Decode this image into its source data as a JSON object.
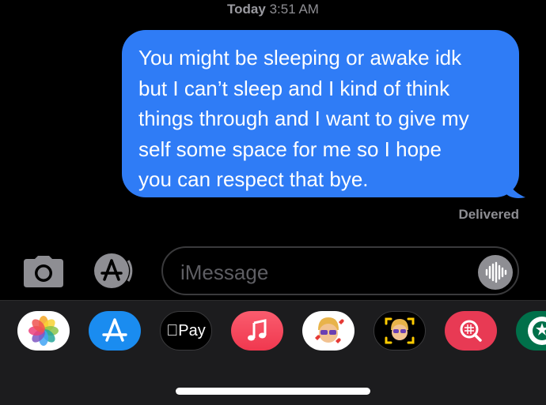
{
  "header": {
    "day": "Today",
    "time": "3:51 AM"
  },
  "message": {
    "text": "You might be sleeping or awake idk\nbut I can’t sleep and I kind of think\nthings through and I want to give my\nself some space for me  so I hope\nyou can respect that bye.",
    "status": "Delivered",
    "bubble_color": "#2f7cf6"
  },
  "composer": {
    "placeholder": "iMessage",
    "camera_icon": "camera-icon",
    "apps_icon": "app-store-icon",
    "audio_icon": "waveform-icon"
  },
  "app_tray": {
    "background": "#1c1c1e",
    "apps": [
      {
        "name": "Photos",
        "icon": "photos-icon"
      },
      {
        "name": "App Store",
        "icon": "app-store-icon"
      },
      {
        "name": "Apple Pay",
        "icon": "apple-pay-icon",
        "label": "Pay"
      },
      {
        "name": "Music",
        "icon": "music-icon"
      },
      {
        "name": "Memoji Stickers",
        "icon": "memoji-icon"
      },
      {
        "name": "Animoji",
        "icon": "animoji-icon"
      },
      {
        "name": "Images Search",
        "icon": "images-search-icon"
      },
      {
        "name": "Starbucks",
        "icon": "starbucks-icon"
      }
    ]
  }
}
